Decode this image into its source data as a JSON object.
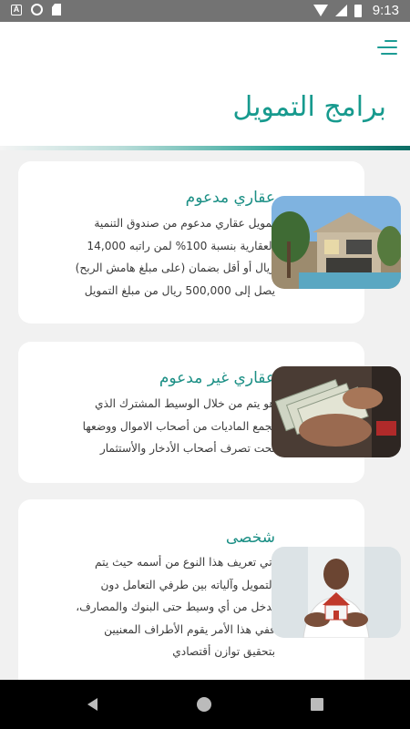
{
  "status_bar": {
    "time": "9:13",
    "left_icons": [
      "a-icon",
      "circle-icon",
      "sd-card-icon"
    ],
    "right_icons": [
      "wifi-icon",
      "signal-icon",
      "battery-icon"
    ]
  },
  "header": {
    "menu_icon": "hamburger-menu-icon",
    "title": "برامج التمويل",
    "accent_color": "#179a8e"
  },
  "cards": [
    {
      "title": "عقاري مدعوم",
      "lines": [
        "تمويل عقاري مدعوم من صندوق التنمية",
        "العقارية بنسبة 100% لمن راتبه 14,000",
        "ريال أو أقل بضمان (على مبلغ هامش الربح)",
        "يصل إلى 500,000 ريال من مبلغ التمويل"
      ],
      "image": "modern-house-photo"
    },
    {
      "title": "عقاري غير مدعوم",
      "lines": [
        "هو يتم من خلال الوسيط المشترك الذي",
        "يجمع الماديات من أصحاب الاموال ووضعها",
        "تحت تصرف أصحاب الأدخار والأستثمار"
      ],
      "image": "money-in-hand-photo"
    },
    {
      "title": "شخصى",
      "lines": [
        "أتي تعريف هذا النوع من أسمه حيث يتم",
        "التمويل وآلياته بين طرفي التعامل دون",
        "تدخل من أي وسيط حتى البنوك والمصارف،",
        "ففي هذا الأمر يقوم الأطراف المعنيين",
        "بتحقيق توازن أقتصادي"
      ],
      "image": "man-holding-house-photo"
    }
  ],
  "nav_bar": {
    "icons": [
      "back-icon",
      "home-icon",
      "recent-apps-icon"
    ]
  }
}
